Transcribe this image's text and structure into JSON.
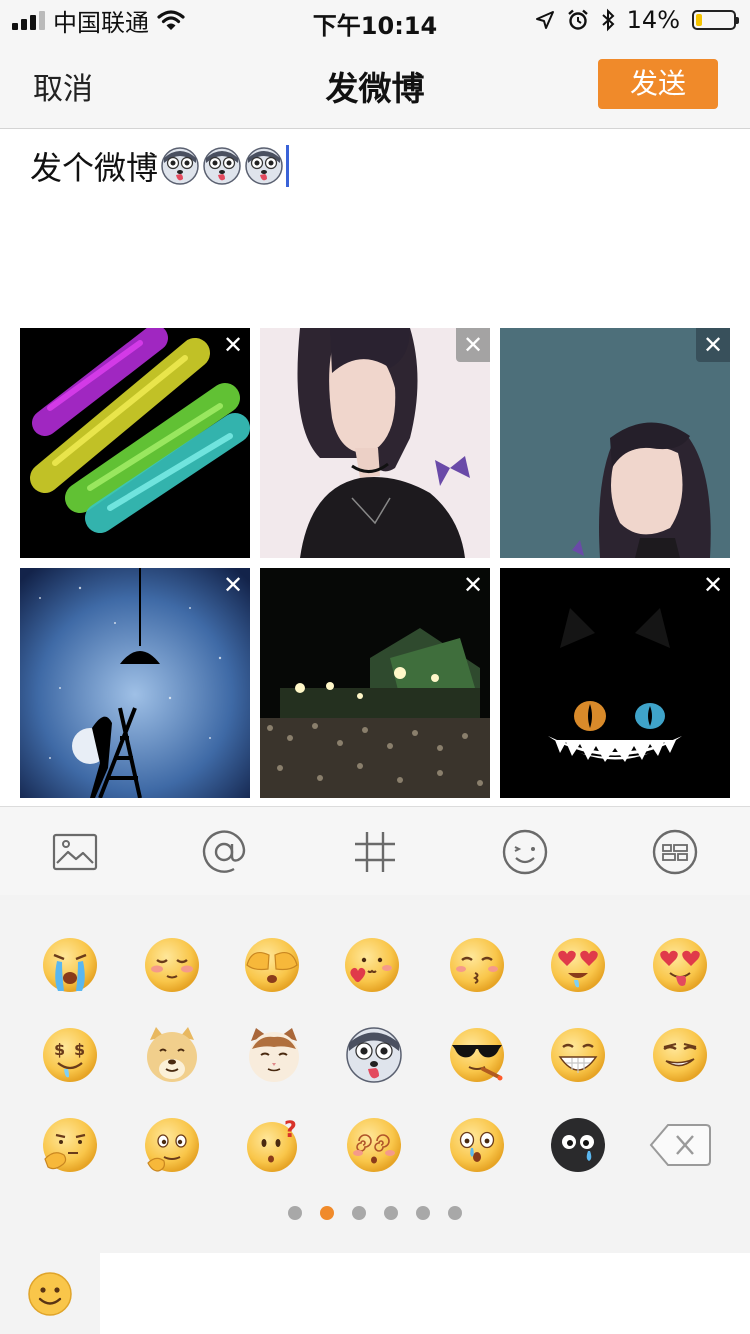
{
  "status_bar": {
    "carrier": "中国联通",
    "time": "下午10:14",
    "battery_percent": "14%",
    "battery_level": 0.14,
    "icons": [
      "signal-icon",
      "wifi-icon",
      "location-icon",
      "alarm-icon",
      "bluetooth-icon",
      "battery-icon"
    ]
  },
  "nav": {
    "cancel_label": "取消",
    "title": "发微博",
    "send_label": "发送",
    "send_color": "#f08a2a"
  },
  "compose": {
    "text": "发个微博",
    "inline_emoji_count": 3,
    "inline_emoji": "husky-emoji"
  },
  "images": [
    {
      "name": "rainbow-brush-strokes",
      "close_label": "✕"
    },
    {
      "name": "girl-with-butterfly",
      "close_label": "✕"
    },
    {
      "name": "girl-teal-background",
      "close_label": "✕"
    },
    {
      "name": "ladder-moon-night",
      "close_label": "✕"
    },
    {
      "name": "concert-crowd",
      "close_label": "✕"
    },
    {
      "name": "black-cat-grin",
      "close_label": "✕"
    }
  ],
  "toolbar": {
    "items": [
      "image-icon",
      "at-icon",
      "hashtag-icon",
      "emoji-icon",
      "more-icon"
    ]
  },
  "emoji_panel": {
    "rows": [
      [
        "crying",
        "shy",
        "cover-eyes",
        "love-heart",
        "kiss",
        "heart-eyes",
        "heart-tongue"
      ],
      [
        "money-eyes",
        "doge",
        "cat",
        "husky",
        "sunglasses",
        "big-grin",
        "smirk"
      ],
      [
        "thinking",
        "drool",
        "question",
        "dizzy",
        "shocked-tear",
        "black-face-tear",
        "delete-key"
      ]
    ],
    "pages": 6,
    "active_page": 2
  },
  "bottom_bar": {
    "tab_icon": "smiley-tab-icon"
  },
  "colors": {
    "accent": "#f08a2a",
    "cursor": "#3a63d8",
    "bar_bg": "#f6f6f6",
    "panel_bg": "#f3f3f3"
  }
}
